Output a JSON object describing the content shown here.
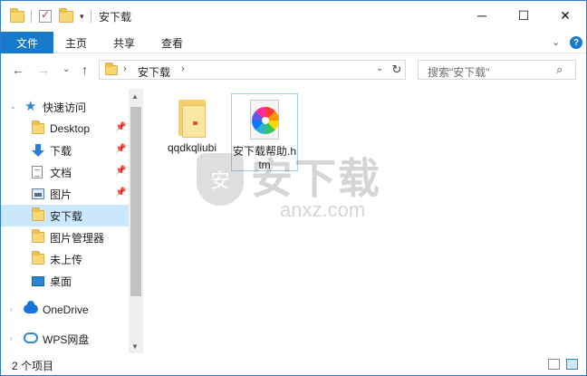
{
  "window": {
    "title": "安下载"
  },
  "title_controls": {
    "minimize": "─",
    "maximize": "☐",
    "close": "✕"
  },
  "ribbon": {
    "tabs": [
      "文件",
      "主页",
      "共享",
      "查看"
    ],
    "collapse": "⌄",
    "help": "?"
  },
  "nav": {
    "back": "←",
    "forward": "→",
    "recent": "⌄",
    "up": "↑",
    "breadcrumb": "安下载",
    "search_placeholder": "搜索\"安下载\"",
    "search_icon": "⌕",
    "refresh": "↻"
  },
  "sidebar": {
    "quick_access": "快速访问",
    "items": [
      {
        "label": "Desktop",
        "icon": "folder-icon",
        "pinned": true
      },
      {
        "label": "下载",
        "icon": "download-arrow-icon",
        "pinned": true
      },
      {
        "label": "文档",
        "icon": "document-icon",
        "pinned": true
      },
      {
        "label": "图片",
        "icon": "picture-icon",
        "pinned": true
      },
      {
        "label": "安下载",
        "icon": "folder-icon",
        "pinned": false,
        "selected": true
      },
      {
        "label": "图片管理器",
        "icon": "folder-icon",
        "pinned": false
      },
      {
        "label": "未上传",
        "icon": "folder-icon",
        "pinned": false
      },
      {
        "label": "桌面",
        "icon": "desktop-icon",
        "pinned": false
      }
    ],
    "onedrive": "OneDrive",
    "wps": "WPS网盘",
    "pin_glyph": "📌"
  },
  "files": [
    {
      "name": "qqdkqliubi",
      "type": "folder"
    },
    {
      "name": "安下载帮助.htm",
      "type": "htm",
      "selected": true
    }
  ],
  "watermark": {
    "mark": "安",
    "title": "安下载",
    "domain": "anxz.com"
  },
  "status": {
    "count": "2 个项目"
  },
  "colors": {
    "accent": "#1979ca",
    "selection": "#cce8ff",
    "folder": "#f6cf68"
  }
}
